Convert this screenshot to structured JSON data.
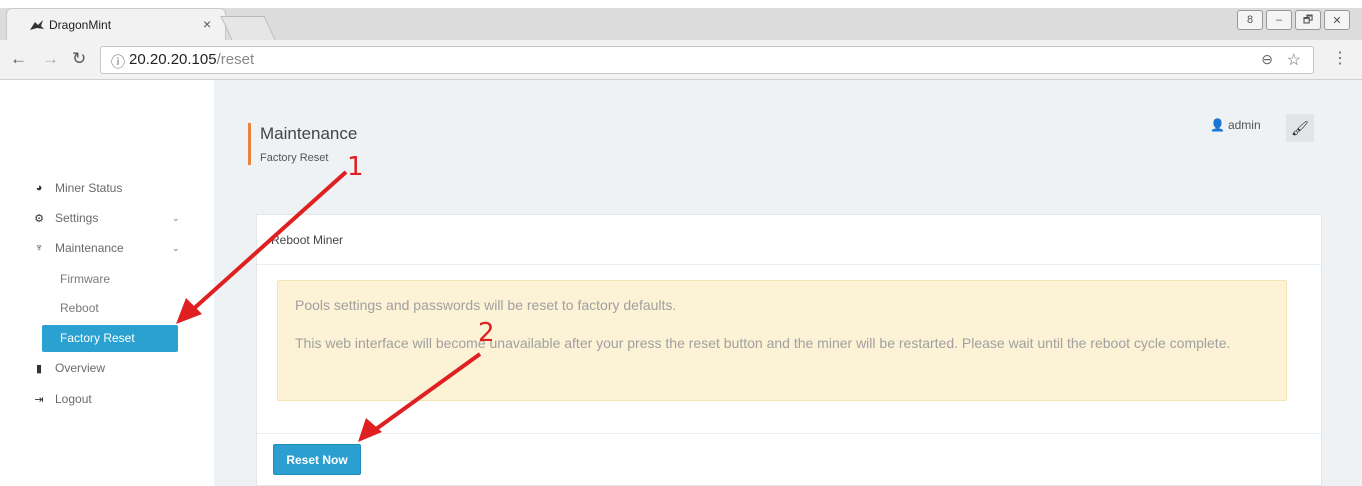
{
  "browser": {
    "tab_title": "DragonMint",
    "tab_close": "×",
    "url_host": "20.20.20.105",
    "url_path": "/reset",
    "win_buttons": [
      "8",
      "–",
      "🗗",
      "✕"
    ]
  },
  "sidebar": {
    "items": [
      {
        "label": "Miner Status",
        "icon": "dashboard-icon"
      },
      {
        "label": "Settings",
        "icon": "cogs-icon"
      },
      {
        "label": "Maintenance",
        "icon": "plug-icon"
      },
      {
        "label": "Overview",
        "icon": "chip-icon"
      },
      {
        "label": "Logout",
        "icon": "sign-out-icon"
      }
    ],
    "sub_items": [
      "Firmware",
      "Reboot",
      "Factory Reset"
    ],
    "active_sub_item": "Factory Reset"
  },
  "header": {
    "title": "Maintenance",
    "subtitle": "Factory Reset",
    "user": "admin"
  },
  "panel": {
    "title": "Reboot Miner",
    "alert_line1": "Pools settings and passwords will be reset to factory defaults.",
    "alert_line2": "This web interface will become unavailable after your press the reset button and the miner will be restarted. Please wait until the reboot cycle complete.",
    "button_label": "Reset Now"
  },
  "annotations": {
    "step1": "1",
    "step2": "2",
    "color": "#e02020"
  }
}
